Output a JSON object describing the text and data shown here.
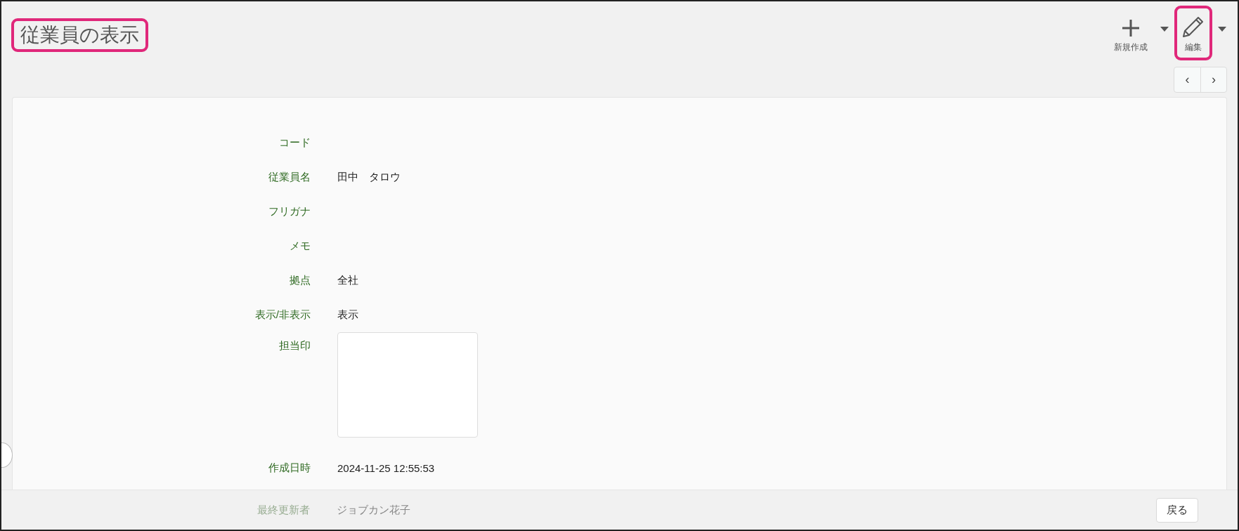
{
  "page": {
    "title": "従業員の表示",
    "highlighted": true
  },
  "toolbar": [
    {
      "kind": "new",
      "label": "新規作成",
      "highlighted": false,
      "has_menu": true
    },
    {
      "kind": "edit",
      "label": "編集",
      "highlighted": true,
      "has_menu": true
    }
  ],
  "pager": [
    {
      "label": "‹"
    },
    {
      "label": "›"
    }
  ],
  "fields": [
    {
      "kind": "text",
      "label": "コード"
    },
    {
      "kind": "text",
      "label": "従業員名",
      "value": "田中　タロウ"
    },
    {
      "kind": "text",
      "label": "フリガナ"
    },
    {
      "kind": "text",
      "label": "メモ"
    },
    {
      "kind": "text",
      "label": "拠点",
      "value": "全社"
    },
    {
      "kind": "text",
      "label": "表示/非表示",
      "value": "表示"
    },
    {
      "kind": "image",
      "label": "担当印"
    },
    {
      "kind": "text",
      "label": "作成日時",
      "value": "2024-11-25 12:55:53"
    },
    {
      "kind": "text",
      "label": "最終更新者",
      "value": "ジョブカン花子"
    }
  ],
  "footer": {
    "back_button": "戻る"
  }
}
